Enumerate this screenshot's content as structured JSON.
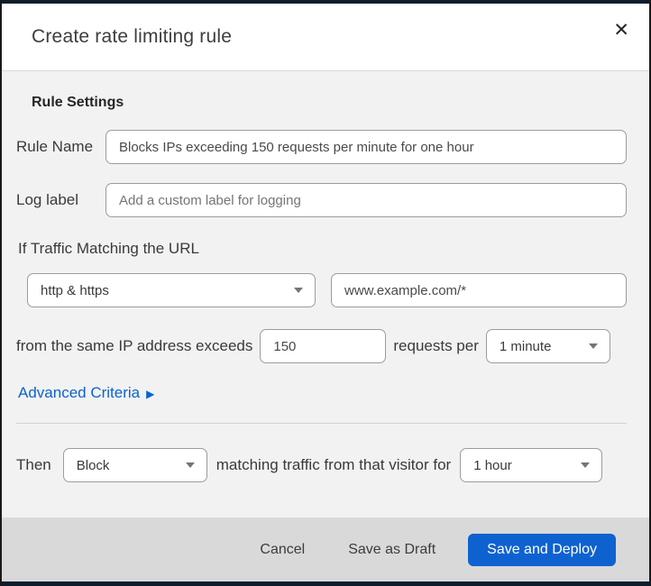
{
  "dialog": {
    "title": "Create rate limiting rule",
    "close_icon": "✕"
  },
  "section": {
    "heading": "Rule Settings"
  },
  "fields": {
    "rule_name": {
      "label": "Rule Name",
      "value": "Blocks IPs exceeding 150 requests per minute for one hour"
    },
    "log_label": {
      "label": "Log label",
      "placeholder": "Add a custom label for logging"
    },
    "traffic_match": {
      "intro": "If Traffic Matching the URL",
      "scheme_selected": "http & https",
      "url_value": "www.example.com/*",
      "threshold_prefix": "from the same IP address exceeds",
      "threshold_value": "150",
      "threshold_suffix": "requests per",
      "period_selected": "1 minute"
    },
    "advanced": {
      "label": "Advanced Criteria",
      "arrow": "▶"
    },
    "action": {
      "prefix": "Then",
      "action_selected": "Block",
      "middle": "matching traffic from that visitor for",
      "duration_selected": "1 hour"
    }
  },
  "footer": {
    "cancel_label": "Cancel",
    "save_draft_label": "Save as Draft",
    "save_deploy_label": "Save and Deploy"
  },
  "colors": {
    "primary_button_blue": "#0e62d0",
    "link_blue": "#0b62ce",
    "body_background": "#f2f2f2",
    "footer_background": "#d9d9d9",
    "top_strip": "#0d1d2c"
  }
}
